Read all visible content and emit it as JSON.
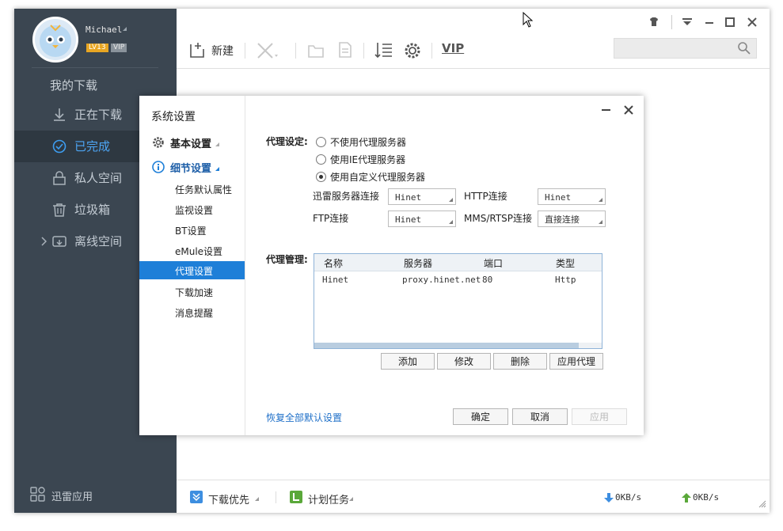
{
  "user": {
    "name": "Michael",
    "level": "LV13",
    "vip": "VIP"
  },
  "sidebar": {
    "section": "我的下载",
    "items": [
      {
        "label": "正在下载",
        "icon": "download-icon"
      },
      {
        "label": "已完成",
        "icon": "check-circle-icon"
      },
      {
        "label": "私人空间",
        "icon": "lock-icon"
      },
      {
        "label": "垃圾箱",
        "icon": "trash-icon"
      },
      {
        "label": "离线空间",
        "icon": "cloud-icon"
      }
    ],
    "apps": "迅雷应用"
  },
  "toolbar": {
    "new_label": "新建",
    "vip_label": "VIP"
  },
  "dialog": {
    "title": "系统设置",
    "tree": {
      "basic": "基本设置",
      "detail": "细节设置",
      "children": [
        "任务默认属性",
        "监视设置",
        "BT设置",
        "eMule设置",
        "代理设置",
        "下载加速",
        "消息提醒"
      ]
    },
    "proxy_setting_label": "代理设定:",
    "radio_options": [
      "不使用代理服务器",
      "使用IE代理服务器",
      "使用自定义代理服务器"
    ],
    "conn": {
      "xunlei_label": "迅雷服务器连接",
      "xunlei_value": "Hinet",
      "http_label": "HTTP连接",
      "http_value": "Hinet",
      "ftp_label": "FTP连接",
      "ftp_value": "Hinet",
      "mms_label": "MMS/RTSP连接",
      "mms_value": "直接连接"
    },
    "manage_label": "代理管理:",
    "table": {
      "headers": [
        "名称",
        "服务器",
        "端口",
        "类型"
      ],
      "rows": [
        {
          "name": "Hinet",
          "server": "proxy.hinet.net",
          "port": "80",
          "type": "Http"
        }
      ]
    },
    "buttons": {
      "add": "添加",
      "edit": "修改",
      "delete": "删除",
      "apply_proxy": "应用代理"
    },
    "restore": "恢复全部默认设置",
    "ok": "确定",
    "cancel": "取消",
    "apply": "应用"
  },
  "statusbar": {
    "priority": "下载优先",
    "schedule": "计划任务",
    "down_speed": "0KB/s",
    "up_speed": "0KB/s"
  }
}
